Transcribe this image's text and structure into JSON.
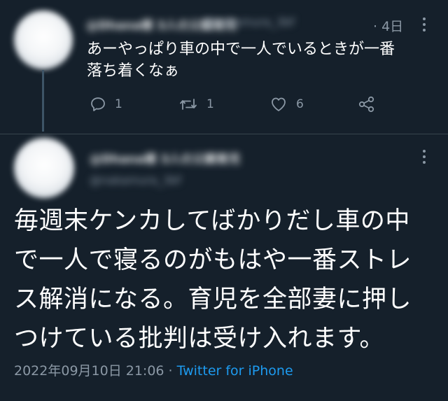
{
  "parent_tweet": {
    "display_name": "@Dhana様 3人の父親育児",
    "handle": "@nakamura_3bf",
    "time": "· 4日",
    "text": "あーやっぱり車の中で一人でいるときが一番\n落ち着くなぁ",
    "reply_count": "1",
    "retweet_count": "1",
    "like_count": "6",
    "icons": [
      "reply-icon",
      "retweet-icon",
      "like-icon",
      "share-icon"
    ]
  },
  "main_tweet": {
    "display_name": "@Dhana様 3人の父親育児",
    "handle": "@nakamura_3bf",
    "text": "毎週末ケンカしてばかりだし車の中\nで一人で寝るのがもはや一番ストレ\nス解消になる。育児を全部妻に押し\nつけている批判は受け入れます。",
    "timestamp": "2022年09月10日 21:06",
    "separator": " · ",
    "source": "Twitter for iPhone"
  },
  "colors": {
    "background": "#15202b",
    "text": "#ffffff",
    "secondary": "#8b98a5",
    "link": "#1d9bf0",
    "divider": "#38444d"
  }
}
